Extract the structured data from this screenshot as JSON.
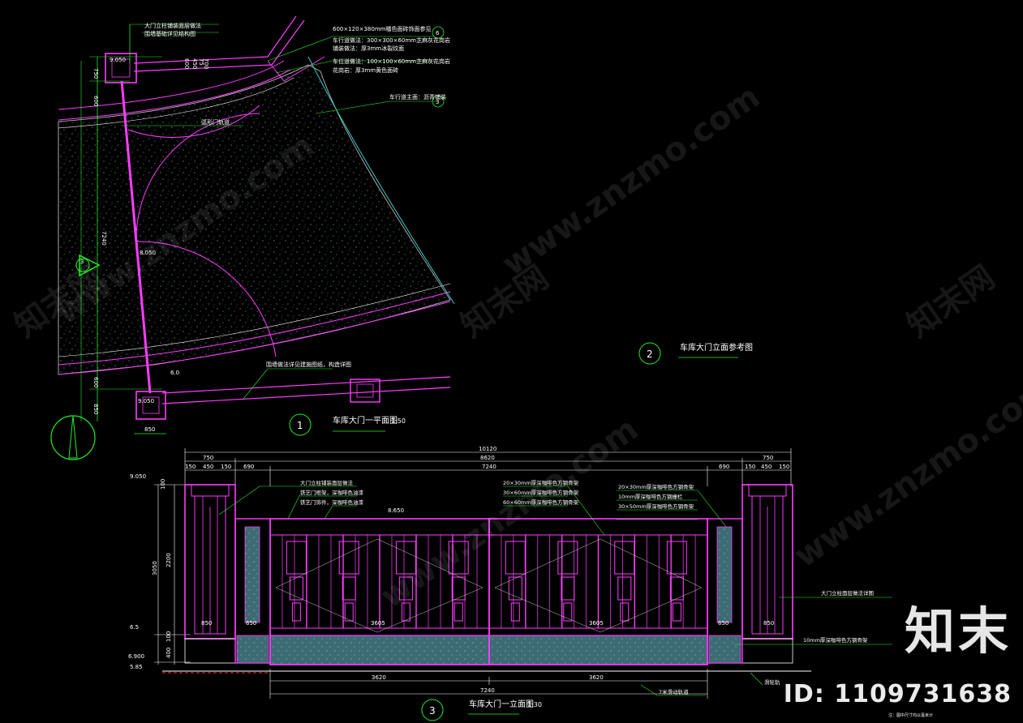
{
  "views": {
    "plan": {
      "title": "车库大门一平面图",
      "scale": "1:50",
      "number": "1"
    },
    "reference": {
      "title": "车库大门立面参考图",
      "number": "2"
    },
    "elevation": {
      "title": "车库大门一立面图",
      "scale": "1:30",
      "number": "3"
    }
  },
  "plan_dims": {
    "top_row": [
      "600",
      "450",
      "75",
      "700"
    ],
    "left_col": [
      "750",
      "600",
      "7240",
      "600",
      "850"
    ],
    "bottom": "850",
    "elev_a": "9.050",
    "elev_b": "9.050",
    "elev_c": "9.050",
    "section_mark": "3",
    "radius_note": "6.0",
    "mid_note": "8.050"
  },
  "plan_labels": {
    "l1": "大门立柱铺装面层做法",
    "l2": "围墙基础详见结构图",
    "l3": "600×120×380mm橘色面砖饰面参见",
    "l4": "车行道做法：300×300×60mm芝麻灰花岗岩",
    "l5": "铺装做法：厚3mm冰裂纹面",
    "l6": "车位道做法：100×100×60mm芝麻灰花岗岩",
    "l7": "花岗岩：厚3mm黄色面砖",
    "l8": "车行道主面：沥青铺装",
    "l9": "弧形门轨道",
    "l10": "围墙做法详见建施图纸，构造详图",
    "sym_a": "6",
    "sym_b": "3"
  },
  "elev_dims": {
    "overall": "10120",
    "mid": "8620",
    "left_outer": "750",
    "right_outer": "750",
    "segs_left": [
      "150",
      "450",
      "150",
      "690"
    ],
    "segs_right": [
      "690",
      "150",
      "450",
      "150"
    ],
    "inner": "7240",
    "bottom_left": "3620",
    "bottom_right": "3620",
    "bottom_total": "7240",
    "gate_left": "3605",
    "gate_right": "3605",
    "leaf_l": "650",
    "leaf_r": "650",
    "pier_l": "850",
    "pier_r": "850",
    "vert": [
      "100",
      "2200",
      "3050",
      "100",
      "400"
    ],
    "lv1": "9.050",
    "lv2": "8.650",
    "lv3": "6.5",
    "lv4": "6.900",
    "lv5": "5.85"
  },
  "elev_labels": {
    "e1": "大门立柱铺装面层做法",
    "e2": "铁艺门框架，深咖啡色油漆",
    "e3": "铁艺门饰件，深咖啡色油漆",
    "e4": "20×30mm厚深咖啡色方钢骨架",
    "e5": "30×60mm厚深咖啡色方钢骨架",
    "e6": "60×60mm厚深咖啡色方钢骨架",
    "e7": "20×30mm厚深咖啡色方钢骨架",
    "e8": "10mm厚深咖啡色方钢栅栏",
    "e9": "30×50mm厚深咖啡色方钢骨架",
    "e10": "大门立柱面层做法详图",
    "e11": "10mm厚深咖啡色方钢骨架",
    "e12": "7米滑动轨道",
    "e13": "滑轮轨",
    "e14": "注：图中尺寸均以毫米计"
  },
  "watermark": {
    "site": "www.znzmo.com",
    "cn": "知末网",
    "brand": "知末",
    "id": "ID: 1109731638"
  },
  "colors": {
    "magenta": "#ff3cff",
    "green": "#22ee22",
    "white": "#ffffff",
    "yellow": "#ffff33",
    "cyan": "#33cccc",
    "teal": "#3d6b74"
  }
}
